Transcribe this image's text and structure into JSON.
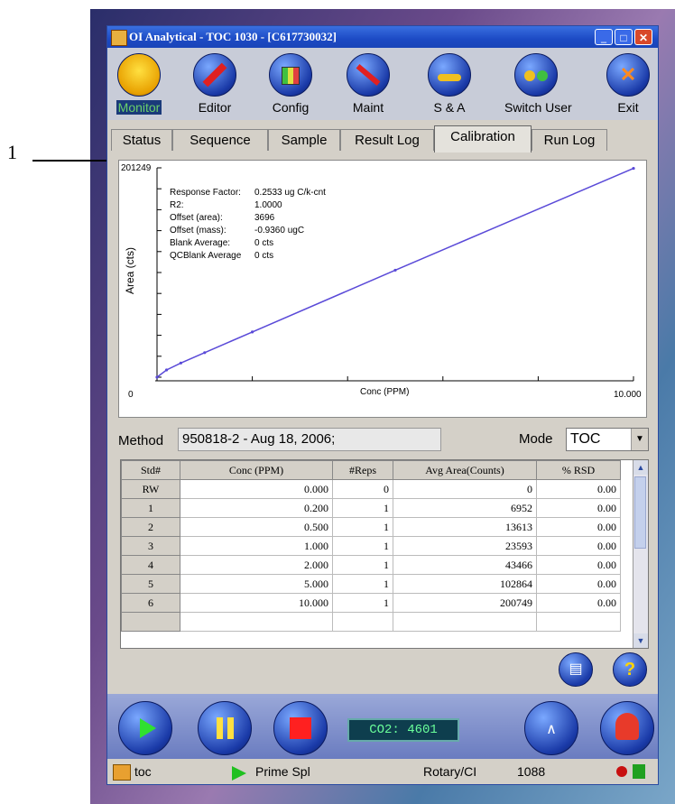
{
  "callout": {
    "number": "1"
  },
  "window": {
    "title": "OI Analytical - TOC 1030 - [C617730032]",
    "controls": {
      "minimize": "_",
      "maximize": "□",
      "close": "✕"
    }
  },
  "toolbar": [
    {
      "label": "Monitor",
      "icon": "gauge-icon",
      "active": true
    },
    {
      "label": "Editor",
      "icon": "pencil-icon"
    },
    {
      "label": "Config",
      "icon": "grid-icon"
    },
    {
      "label": "Maint",
      "icon": "screwdriver-icon"
    },
    {
      "label": "S & A",
      "icon": "key-icon"
    },
    {
      "label": "Switch User",
      "icon": "users-icon"
    },
    {
      "label": "Exit",
      "icon": "close-icon"
    }
  ],
  "tabs": [
    "Status",
    "Sequence",
    "Sample",
    "Result Log",
    "Calibration",
    "Run Log"
  ],
  "active_tab": "Calibration",
  "calibration": {
    "stats": [
      {
        "label": "Response Factor:",
        "value": "0.2533 ug C/k-cnt"
      },
      {
        "label": "R2:",
        "value": "1.0000"
      },
      {
        "label": "Offset (area):",
        "value": "3696"
      },
      {
        "label": "Offset (mass):",
        "value": "-0.9360 ugC"
      },
      {
        "label": "Blank Average:",
        "value": "0 cts"
      },
      {
        "label": "QCBlank Average",
        "value": "0 cts"
      }
    ]
  },
  "chart_data": {
    "type": "line",
    "xlabel": "Conc (PPM)",
    "ylabel": "Area (cts)",
    "x_tick_labels": [
      "0",
      "10.000"
    ],
    "y_top_label": "201249",
    "xlim": [
      0,
      10
    ],
    "ylim": [
      0,
      201249
    ],
    "series": [
      {
        "x": [
          0.0,
          0.2,
          0.5,
          1.0,
          2.0,
          5.0,
          10.0
        ],
        "y": [
          0,
          6952,
          13613,
          23593,
          43466,
          102864,
          200749
        ]
      }
    ],
    "grid": false
  },
  "method": {
    "label": "Method",
    "value": "950818-2 - Aug 18, 2006;",
    "mode_label": "Mode",
    "mode_value": "TOC"
  },
  "table": {
    "columns": [
      "Std#",
      "Conc (PPM)",
      "#Reps",
      "Avg Area(Counts)",
      "% RSD"
    ],
    "rows": [
      [
        "RW",
        "0.000",
        "0",
        "0",
        "0.00"
      ],
      [
        "1",
        "0.200",
        "1",
        "6952",
        "0.00"
      ],
      [
        "2",
        "0.500",
        "1",
        "13613",
        "0.00"
      ],
      [
        "3",
        "1.000",
        "1",
        "23593",
        "0.00"
      ],
      [
        "4",
        "2.000",
        "1",
        "43466",
        "0.00"
      ],
      [
        "5",
        "5.000",
        "1",
        "102864",
        "0.00"
      ],
      [
        "6",
        "10.000",
        "1",
        "200749",
        "0.00"
      ]
    ]
  },
  "controls": {
    "co2_readout": "CO2: 4601",
    "help": "?"
  },
  "statusbar": {
    "user": "toc",
    "state": "Prime Spl",
    "mode": "Rotary/CI",
    "value": "1088"
  }
}
